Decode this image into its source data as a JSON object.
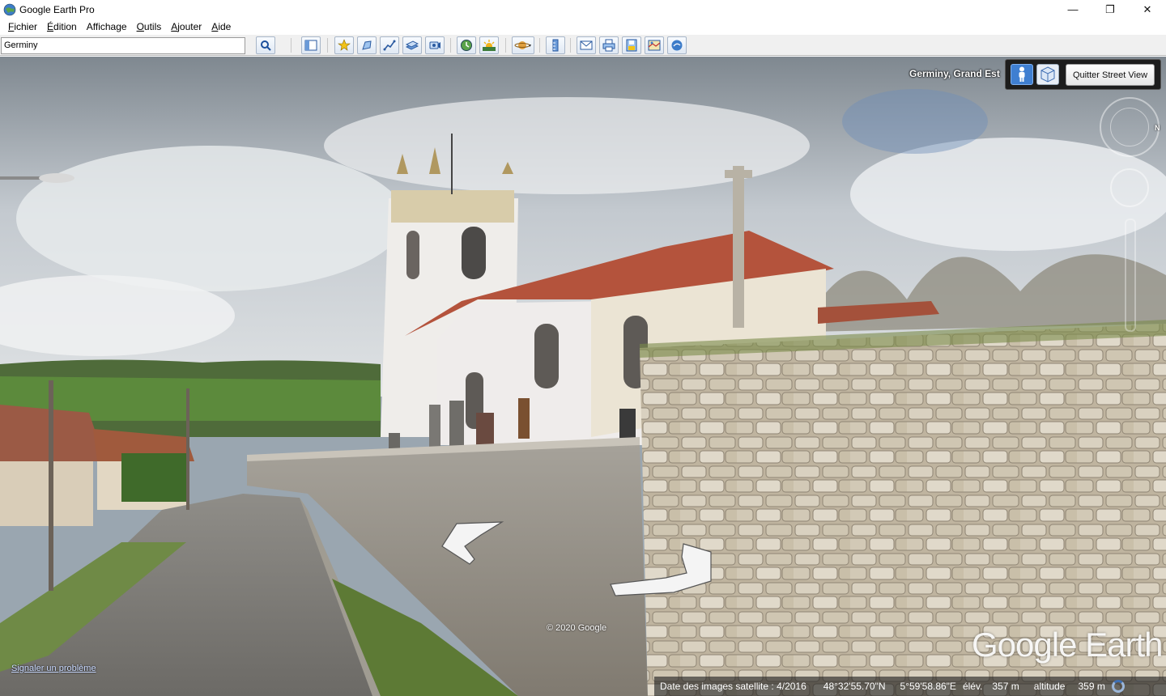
{
  "window": {
    "title": "Google Earth Pro",
    "controls": {
      "minimize": "—",
      "maximize": "❐",
      "close": "✕"
    }
  },
  "menu": [
    {
      "label": "Fichier",
      "accel": "F",
      "rest": "ichier"
    },
    {
      "label": "Édition",
      "accel": "É",
      "rest": "dition"
    },
    {
      "label": "Affichage",
      "accel": "",
      "rest": "Affichage"
    },
    {
      "label": "Outils",
      "accel": "O",
      "rest": "utils"
    },
    {
      "label": "Ajouter",
      "accel": "A",
      "rest": "jouter"
    },
    {
      "label": "Aide",
      "accel": "A",
      "rest": "ide"
    }
  ],
  "search": {
    "value": "Germiny"
  },
  "toolbar_icons": [
    "search-icon",
    "sidebar-icon",
    "placemark-icon",
    "polygon-icon",
    "path-icon",
    "overlay-icon",
    "tour-icon",
    "historical-imagery-icon",
    "sunlight-icon",
    "planets-icon",
    "ruler-icon",
    "email-icon",
    "print-icon",
    "save-image-icon",
    "map-view-icon",
    "google-maps-icon"
  ],
  "streetview": {
    "location": "Germiny, Grand Est",
    "quit_label": "Quitter Street View",
    "compass_north": "N",
    "copyright": "© 2020 Google",
    "report_link": "Signaler un problème",
    "logo": "Google Earth"
  },
  "status": {
    "imagery_date": "Date des images satellite : 4/2016",
    "lat": "48°32'55.70\"N",
    "lon": "5°59'58.86\"E",
    "elev_label": "élév.",
    "elev_value": "357 m",
    "alt_label": "altitude",
    "alt_value": "359 m"
  }
}
